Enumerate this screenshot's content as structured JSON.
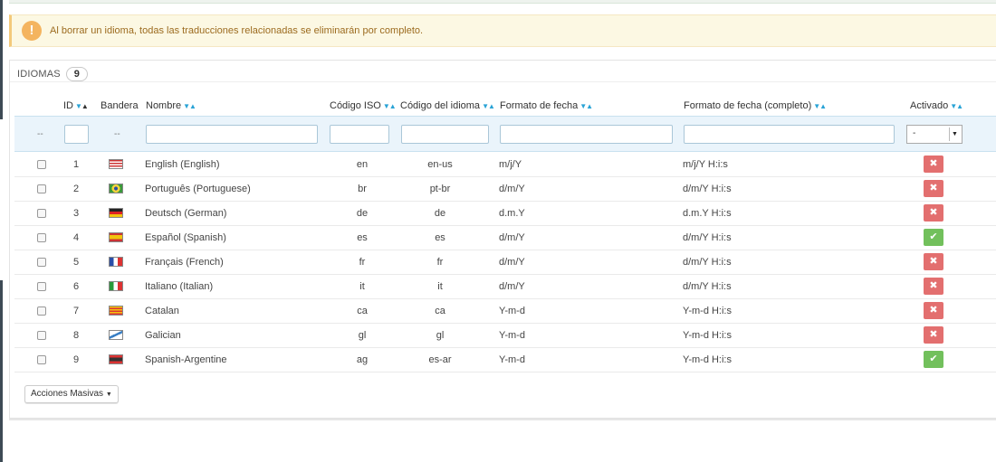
{
  "alert": {
    "icon": "warning-icon",
    "text": "Al borrar un idioma, todas las traducciones relacionadas se eliminarán por completo."
  },
  "panel": {
    "title": "IDIOMAS",
    "count": "9"
  },
  "columns": {
    "id": "ID",
    "flag": "Bandera",
    "name": "Nombre",
    "iso": "Código ISO",
    "lang_code": "Código del idioma",
    "date_format": "Formato de fecha",
    "date_format_full": "Formato de fecha (completo)",
    "active": "Activado"
  },
  "filters": {
    "select_dash": "--",
    "flag_dash": "--",
    "active_value": "-"
  },
  "rows": [
    {
      "id": "1",
      "name": "English (English)",
      "iso": "en",
      "code": "en-us",
      "date": "m/j/Y",
      "date_full": "m/j/Y H:i:s",
      "active": false,
      "flag": "us"
    },
    {
      "id": "2",
      "name": "Português (Portuguese)",
      "iso": "br",
      "code": "pt-br",
      "date": "d/m/Y",
      "date_full": "d/m/Y H:i:s",
      "active": false,
      "flag": "br"
    },
    {
      "id": "3",
      "name": "Deutsch (German)",
      "iso": "de",
      "code": "de",
      "date": "d.m.Y",
      "date_full": "d.m.Y H:i:s",
      "active": false,
      "flag": "de"
    },
    {
      "id": "4",
      "name": "Español (Spanish)",
      "iso": "es",
      "code": "es",
      "date": "d/m/Y",
      "date_full": "d/m/Y H:i:s",
      "active": true,
      "flag": "es"
    },
    {
      "id": "5",
      "name": "Français (French)",
      "iso": "fr",
      "code": "fr",
      "date": "d/m/Y",
      "date_full": "d/m/Y H:i:s",
      "active": false,
      "flag": "fr"
    },
    {
      "id": "6",
      "name": "Italiano (Italian)",
      "iso": "it",
      "code": "it",
      "date": "d/m/Y",
      "date_full": "d/m/Y H:i:s",
      "active": false,
      "flag": "it"
    },
    {
      "id": "7",
      "name": "Catalan",
      "iso": "ca",
      "code": "ca",
      "date": "Y-m-d",
      "date_full": "Y-m-d H:i:s",
      "active": false,
      "flag": "ca"
    },
    {
      "id": "8",
      "name": "Galician",
      "iso": "gl",
      "code": "gl",
      "date": "Y-m-d",
      "date_full": "Y-m-d H:i:s",
      "active": false,
      "flag": "gl"
    },
    {
      "id": "9",
      "name": "Spanish-Argentine",
      "iso": "ag",
      "code": "es-ar",
      "date": "Y-m-d",
      "date_full": "Y-m-d H:i:s",
      "active": true,
      "flag": "ar"
    }
  ],
  "bulk_actions": "Acciones Masivas",
  "colors": {
    "accent": "#29a3d6",
    "disabled": "#e36f6f",
    "enabled": "#72c05c",
    "alert_bg": "#fcf8e3"
  }
}
